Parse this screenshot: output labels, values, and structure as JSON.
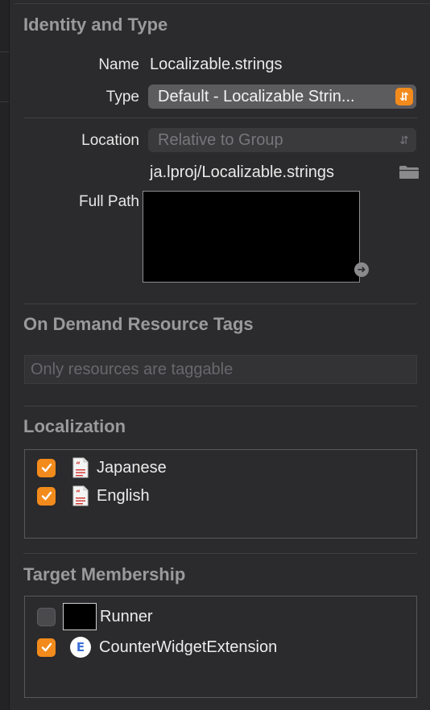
{
  "identity": {
    "title": "Identity and Type",
    "name_label": "Name",
    "name_value": "Localizable.strings",
    "type_label": "Type",
    "type_value": "Default - Localizable Strin...",
    "location_label": "Location",
    "location_value": "Relative to Group",
    "relative_path": "ja.lproj/Localizable.strings",
    "full_path_label": "Full Path"
  },
  "on_demand": {
    "title": "On Demand Resource Tags",
    "placeholder": "Only resources are taggable"
  },
  "localization": {
    "title": "Localization",
    "items": [
      {
        "label": "Japanese",
        "checked": true
      },
      {
        "label": "English",
        "checked": true
      }
    ]
  },
  "target_membership": {
    "title": "Target Membership",
    "items": [
      {
        "label": "Runner",
        "checked": false
      },
      {
        "label": "CounterWidgetExtension",
        "checked": true,
        "icon_letter": "E"
      }
    ]
  },
  "colors": {
    "accent": "#f28b1c",
    "background": "#2b2a2c",
    "section_title": "#9a999b"
  }
}
